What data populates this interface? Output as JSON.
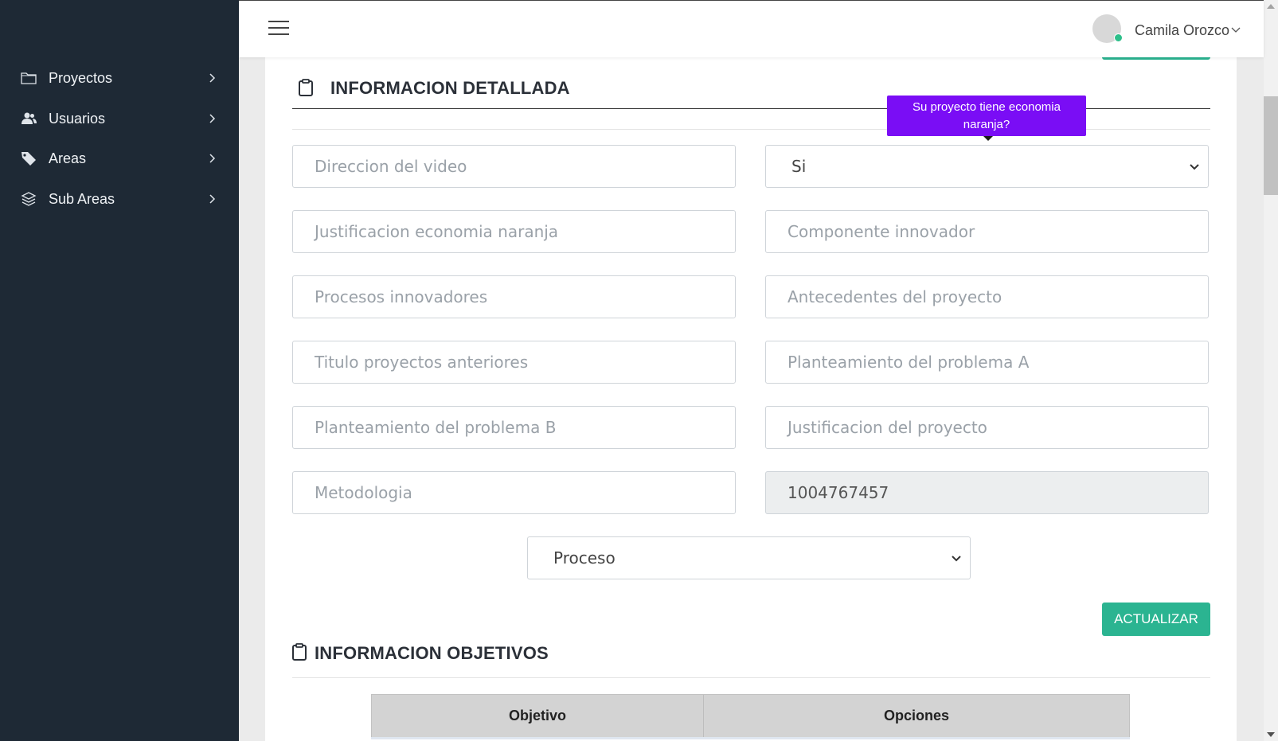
{
  "sidebar": {
    "items": [
      {
        "label": "Proyectos",
        "icon": "folder-icon"
      },
      {
        "label": "Usuarios",
        "icon": "users-icon"
      },
      {
        "label": "Areas",
        "icon": "tag-icon"
      },
      {
        "label": "Sub Areas",
        "icon": "layers-icon"
      }
    ]
  },
  "topbar": {
    "user_name": "Camila Orozco"
  },
  "detail_section": {
    "title": "INFORMACION DETALLADA",
    "tooltip": "Su proyecto tiene economia naranja?",
    "fields": {
      "video_url": {
        "placeholder": "Direccion del video"
      },
      "orange_economy": {
        "value": "Si"
      },
      "orange_justification": {
        "placeholder": "Justificacion economia naranja"
      },
      "innovative_component": {
        "placeholder": "Componente innovador"
      },
      "innovative_processes": {
        "placeholder": "Procesos innovadores"
      },
      "project_background": {
        "placeholder": "Antecedentes del proyecto"
      },
      "previous_titles": {
        "placeholder": "Titulo proyectos anteriores"
      },
      "problem_a": {
        "placeholder": "Planteamiento del problema A"
      },
      "problem_b": {
        "placeholder": "Planteamiento del problema B"
      },
      "project_justification": {
        "placeholder": "Justificacion del proyecto"
      },
      "methodology": {
        "placeholder": "Metodologia"
      },
      "id_number": {
        "value": "1004767457"
      },
      "status": {
        "value": "Proceso"
      }
    },
    "update_button": "ACTUALIZAR"
  },
  "objectives_section": {
    "title": "INFORMACION OBJETIVOS",
    "table": {
      "columns": [
        "Objetivo",
        "Opciones"
      ]
    }
  },
  "colors": {
    "sidebar_bg": "#1e2935",
    "accent_green": "#2bb491",
    "tooltip_purple": "#7a0df5",
    "status_online": "#2dbf8a"
  }
}
